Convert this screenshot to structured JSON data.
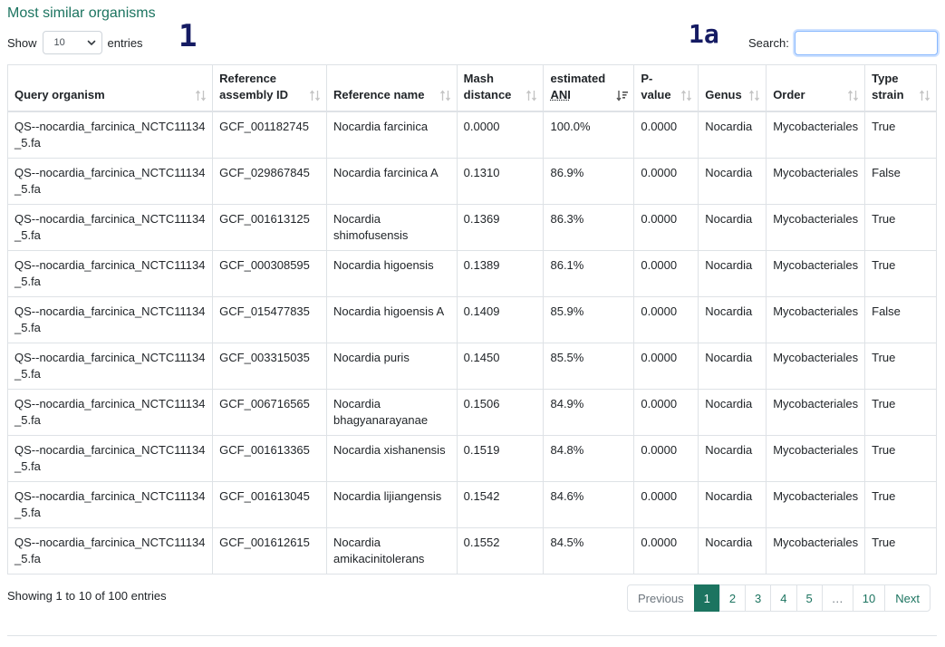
{
  "page": {
    "title": "Most similar organisms"
  },
  "annotations": {
    "a1": "1",
    "a1a": "1a"
  },
  "length_control": {
    "prefix": "Show",
    "selected": "10",
    "suffix": "entries"
  },
  "search": {
    "label": "Search:",
    "value": ""
  },
  "table": {
    "columns": [
      {
        "label": "Query organism",
        "sort_icon": "sort-both-icon"
      },
      {
        "label": "Reference assembly ID",
        "sort_icon": "sort-both-icon"
      },
      {
        "label": "Reference name",
        "sort_icon": "sort-both-icon"
      },
      {
        "label": "Mash distance",
        "sort_icon": "sort-both-icon"
      },
      {
        "label_pre": "estimated ",
        "label_abbr": "ANI",
        "sort_icon": "sort-desc-icon"
      },
      {
        "label": "P-value",
        "sort_icon": "sort-both-icon"
      },
      {
        "label": "Genus",
        "sort_icon": "sort-both-icon"
      },
      {
        "label": "Order",
        "sort_icon": "sort-both-icon"
      },
      {
        "label": "Type strain",
        "sort_icon": "sort-both-icon"
      }
    ],
    "rows": [
      [
        "QS--nocardia_farcinica_NCTC11134_5.fa",
        "GCF_001182745",
        "Nocardia farcinica",
        "0.0000",
        "100.0%",
        "0.0000",
        "Nocardia",
        "Mycobacteriales",
        "True"
      ],
      [
        "QS--nocardia_farcinica_NCTC11134_5.fa",
        "GCF_029867845",
        "Nocardia farcinica A",
        "0.1310",
        "86.9%",
        "0.0000",
        "Nocardia",
        "Mycobacteriales",
        "False"
      ],
      [
        "QS--nocardia_farcinica_NCTC11134_5.fa",
        "GCF_001613125",
        "Nocardia shimofusensis",
        "0.1369",
        "86.3%",
        "0.0000",
        "Nocardia",
        "Mycobacteriales",
        "True"
      ],
      [
        "QS--nocardia_farcinica_NCTC11134_5.fa",
        "GCF_000308595",
        "Nocardia higoensis",
        "0.1389",
        "86.1%",
        "0.0000",
        "Nocardia",
        "Mycobacteriales",
        "True"
      ],
      [
        "QS--nocardia_farcinica_NCTC11134_5.fa",
        "GCF_015477835",
        "Nocardia higoensis A",
        "0.1409",
        "85.9%",
        "0.0000",
        "Nocardia",
        "Mycobacteriales",
        "False"
      ],
      [
        "QS--nocardia_farcinica_NCTC11134_5.fa",
        "GCF_003315035",
        "Nocardia puris",
        "0.1450",
        "85.5%",
        "0.0000",
        "Nocardia",
        "Mycobacteriales",
        "True"
      ],
      [
        "QS--nocardia_farcinica_NCTC11134_5.fa",
        "GCF_006716565",
        "Nocardia bhagyanarayanae",
        "0.1506",
        "84.9%",
        "0.0000",
        "Nocardia",
        "Mycobacteriales",
        "True"
      ],
      [
        "QS--nocardia_farcinica_NCTC11134_5.fa",
        "GCF_001613365",
        "Nocardia xishanensis",
        "0.1519",
        "84.8%",
        "0.0000",
        "Nocardia",
        "Mycobacteriales",
        "True"
      ],
      [
        "QS--nocardia_farcinica_NCTC11134_5.fa",
        "GCF_001613045",
        "Nocardia lijiangensis",
        "0.1542",
        "84.6%",
        "0.0000",
        "Nocardia",
        "Mycobacteriales",
        "True"
      ],
      [
        "QS--nocardia_farcinica_NCTC11134_5.fa",
        "GCF_001612615",
        "Nocardia amikacinitolerans",
        "0.1552",
        "84.5%",
        "0.0000",
        "Nocardia",
        "Mycobacteriales",
        "True"
      ]
    ]
  },
  "footer": {
    "info": "Showing 1 to 10 of 100 entries"
  },
  "pagination": {
    "previous": "Previous",
    "pages": [
      "1",
      "2",
      "3",
      "4",
      "5",
      "…",
      "10"
    ],
    "active": "1",
    "next": "Next"
  },
  "colors": {
    "accent": "#1c7460",
    "annotation": "#151b63",
    "border": "#dee2e6"
  }
}
